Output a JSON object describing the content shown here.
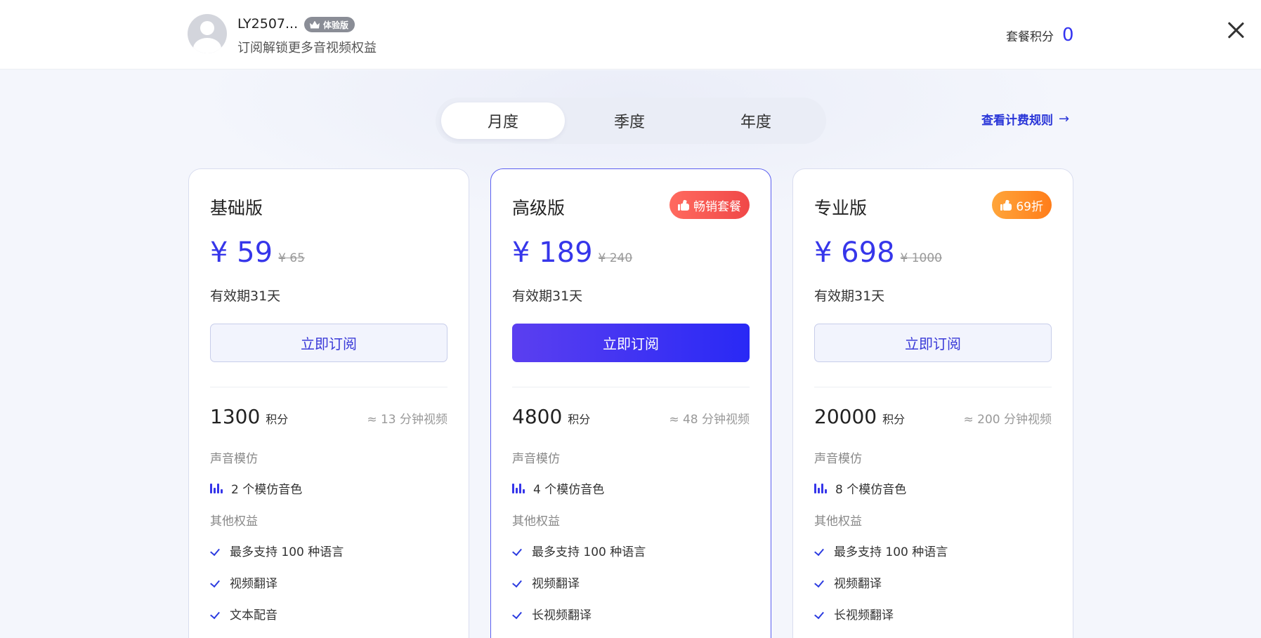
{
  "header": {
    "username": "LY2507...",
    "badge": "体验版",
    "subtitle": "订阅解锁更多音视频权益",
    "points_label": "套餐积分",
    "points_value": "0"
  },
  "tabs": [
    "月度",
    "季度",
    "年度"
  ],
  "active_tab": "月度",
  "rules_link": "查看计费规则",
  "plans": [
    {
      "name": "基础版",
      "tag": "",
      "price": "¥ 59",
      "original_price": "¥ 65",
      "validity": "有效期31天",
      "button": "立即订阅",
      "credits": "1300",
      "credits_unit": "积分",
      "credits_approx": "≈ 13 分钟视频",
      "voice_section": "声音模仿",
      "voice_feature": "2 个模仿音色",
      "other_section": "其他权益",
      "features": [
        "最多支持 100 种语言",
        "视频翻译",
        "文本配音"
      ]
    },
    {
      "name": "高级版",
      "tag": "畅销套餐",
      "price": "¥ 189",
      "original_price": "¥ 240",
      "validity": "有效期31天",
      "button": "立即订阅",
      "credits": "4800",
      "credits_unit": "积分",
      "credits_approx": "≈ 48 分钟视频",
      "voice_section": "声音模仿",
      "voice_feature": "4 个模仿音色",
      "other_section": "其他权益",
      "features": [
        "最多支持 100 种语言",
        "视频翻译",
        "长视频翻译"
      ]
    },
    {
      "name": "专业版",
      "tag": "69折",
      "price": "¥ 698",
      "original_price": "¥ 1000",
      "validity": "有效期31天",
      "button": "立即订阅",
      "credits": "20000",
      "credits_unit": "积分",
      "credits_approx": "≈ 200 分钟视频",
      "voice_section": "声音模仿",
      "voice_feature": "8 个模仿音色",
      "other_section": "其他权益",
      "features": [
        "最多支持 100 种语言",
        "视频翻译",
        "长视频翻译"
      ]
    }
  ],
  "colors": {
    "accent": "#3636ea",
    "hot_tag": "#f04848",
    "discount_tag": "#ff7d1a",
    "primary_button": "#2929f5"
  },
  "icons": [
    "close-icon",
    "crown-icon",
    "thumbs-up-icon",
    "voice-wave-icon",
    "check-icon",
    "arrow-right-icon"
  ]
}
